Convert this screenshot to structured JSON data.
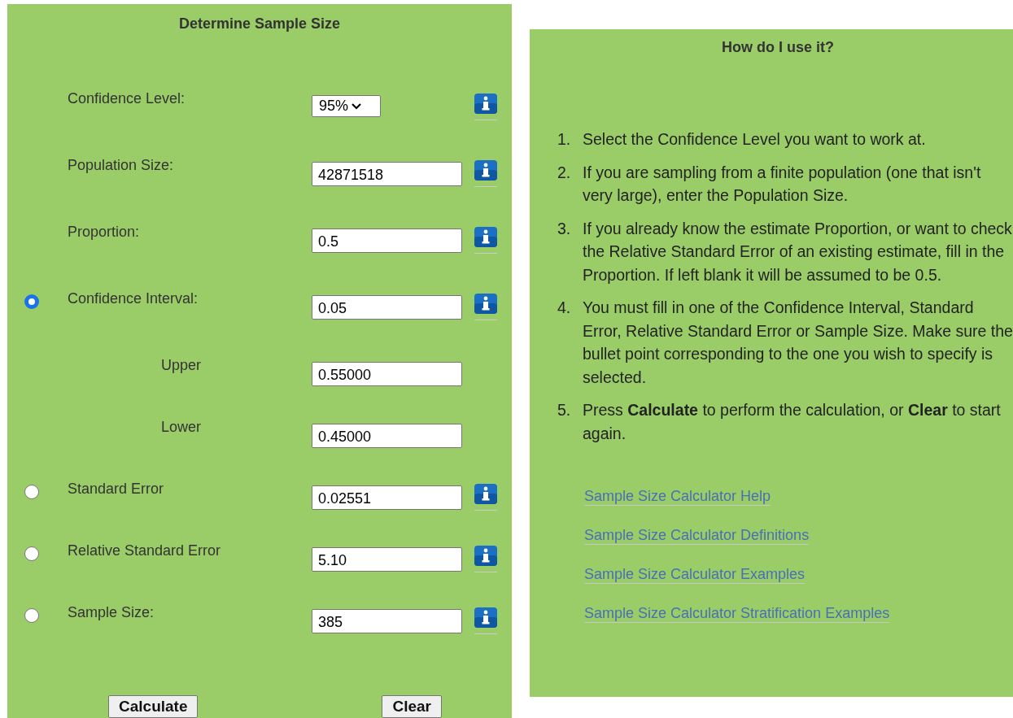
{
  "calculator": {
    "title": "Determine Sample Size",
    "rows": [
      {
        "kind": "select",
        "label": "Confidence Level:",
        "value": "95%",
        "info": true
      },
      {
        "kind": "field",
        "label": "Population Size:",
        "value": "42871518",
        "info": true
      },
      {
        "kind": "field",
        "label": "Proportion:",
        "value": "0.5",
        "info": true
      },
      {
        "kind": "radio",
        "selected": true,
        "label": "Confidence Interval:",
        "value": "0.05",
        "info": true
      },
      {
        "kind": "subfield",
        "label": "Upper",
        "value": "0.55000",
        "info": false
      },
      {
        "kind": "subfield",
        "label": "Lower",
        "value": "0.45000",
        "info": false
      },
      {
        "kind": "radio",
        "selected": false,
        "label": "Standard Error",
        "value": "0.02551",
        "info": true
      },
      {
        "kind": "radio",
        "selected": false,
        "label": "Relative Standard Error",
        "value": "5.10",
        "info": true
      },
      {
        "kind": "radio",
        "selected": false,
        "label": "Sample Size:",
        "value": "385",
        "info": true
      }
    ],
    "buttons": [
      "Calculate",
      "Clear"
    ]
  },
  "help": {
    "title": "How do I use it?",
    "steps": [
      {
        "number": "1.",
        "text": "Select the Confidence Level you want to work at."
      },
      {
        "number": "2.",
        "text": "If you are sampling from a finite population (one that isn't very large), enter the Population Size."
      },
      {
        "number": "3.",
        "text": "If you already know the estimate Proportion, or want to check the Relative Standard Error of an existing estimate, fill in the Proportion. If left blank it will be assumed to be 0.5."
      },
      {
        "number": "4.",
        "text": "You must fill in one of the Confidence Interval, Standard Error, Relative Standard Error or Sample Size. Make sure the bullet point corresponding to the one you wish to specify is selected."
      },
      {
        "number": "5.",
        "text": "Press **Calculate** to perform the calculation, or **Clear** to start again."
      }
    ],
    "links": [
      "Sample Size Calculator Help",
      "Sample Size Calculator Definitions",
      "Sample Size Calculator Examples",
      "Sample Size Calculator Stratification Examples"
    ]
  }
}
